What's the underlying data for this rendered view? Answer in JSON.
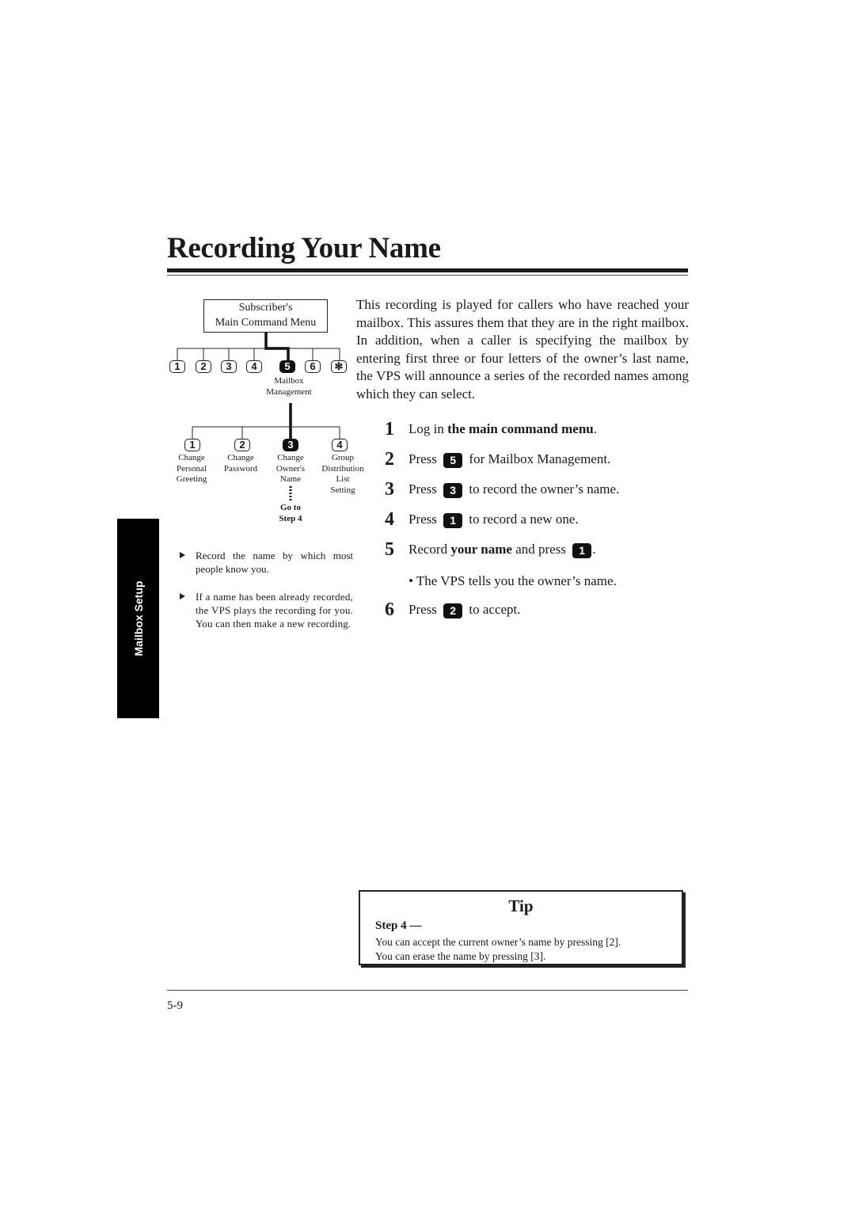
{
  "title": "Recording Your Name",
  "side_tab": "Mailbox Setup",
  "diagram": {
    "menu_box_line1": "Subscriber's",
    "menu_box_line2": "Main Command Menu",
    "top_keys": [
      "1",
      "2",
      "3",
      "4",
      "5",
      "6",
      "✻"
    ],
    "top_selected": "5",
    "top_selected_label_line1": "Mailbox",
    "top_selected_label_line2": "Management",
    "sub_keys": [
      {
        "key": "1",
        "label": [
          "Change",
          "Personal",
          "Greeting"
        ]
      },
      {
        "key": "2",
        "label": [
          "Change",
          "Password"
        ]
      },
      {
        "key": "3",
        "label": [
          "Change",
          "Owner's",
          "Name"
        ],
        "selected": true
      },
      {
        "key": "4",
        "label": [
          "Group",
          "Distribution",
          "List",
          "Setting"
        ]
      }
    ],
    "goto_line1": "Go to",
    "goto_line2": "Step 4"
  },
  "notes": [
    "Record the name by which most people know you.",
    "If a name has been already recorded, the VPS plays the recording for you. You can then make a new recording."
  ],
  "intro": "This recording is played for callers who have reached your mailbox. This assures them that they are in the right mailbox. In addition, when a caller is specifying the mailbox by entering first three or four letters of the owner’s last name, the VPS will announce a series of the recorded names among which they can select.",
  "steps": [
    {
      "num": "1",
      "pre": "Log in ",
      "bold": "the main command menu",
      "post": "."
    },
    {
      "num": "2",
      "pre": "Press",
      "key": "5",
      "post": "for Mailbox Management."
    },
    {
      "num": "3",
      "pre": "Press",
      "key": "3",
      "post": "to record the owner’s name."
    },
    {
      "num": "4",
      "pre": "Press",
      "key": "1",
      "post": "to record a new one."
    },
    {
      "num": "5",
      "pre": "Record ",
      "bold": "your name",
      "mid": " and press",
      "key": "1",
      "post": "."
    },
    {
      "num": "6",
      "pre": "Press",
      "key": "2",
      "post": "to accept."
    }
  ],
  "step5_sub": "• The VPS tells you the owner’s name.",
  "tip": {
    "title": "Tip",
    "heading": "Step 4 —",
    "line1": "You can accept the current owner’s name by pressing [2].",
    "line2": "You can erase the name by pressing [3]."
  },
  "page_number": "5-9"
}
